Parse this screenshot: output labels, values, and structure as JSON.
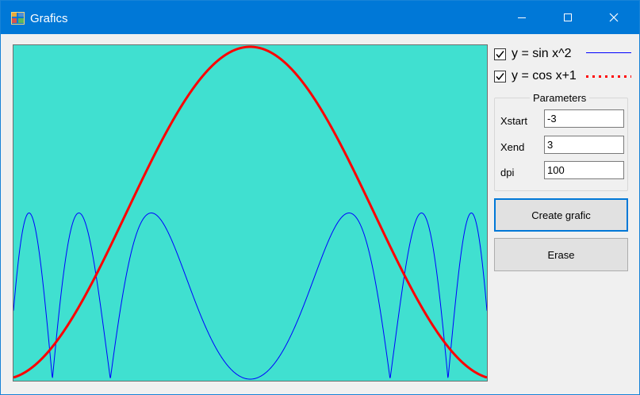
{
  "window": {
    "title": "Grafics",
    "app_icon": "windows-forms-icon",
    "controls": [
      "minimize-icon",
      "maximize-icon",
      "close-icon"
    ]
  },
  "checkboxes": [
    {
      "label": "y = sin x^2",
      "checked": true,
      "legend_style": "solid",
      "legend_color": "#0000ff"
    },
    {
      "label": "y = cos x+1",
      "checked": true,
      "legend_style": "dotted",
      "legend_color": "#ff0000"
    }
  ],
  "parameters": {
    "group_title": "Parameters",
    "xstart_label": "Xstart",
    "xstart_value": "-3",
    "xend_label": "Xend",
    "xend_value": "3",
    "dpi_label": "dpi",
    "dpi_value": "100"
  },
  "buttons": {
    "create_label": "Create grafic",
    "erase_label": "Erase"
  },
  "chart_data": {
    "type": "line",
    "background": "#40e0d0",
    "xlim": [
      -3,
      3
    ],
    "ylim": [
      0,
      2
    ],
    "grid": false,
    "series": [
      {
        "name": "y = sin x^2",
        "color": "#0000ff",
        "width": 1,
        "function": "sin(x^2)",
        "plotted_as": "abs",
        "x": [
          -3,
          -2.5,
          -2,
          -1.5,
          -1,
          -0.5,
          0,
          0.5,
          1,
          1.5,
          2,
          2.5,
          3
        ],
        "y": [
          0.41,
          0.03,
          0.76,
          0.78,
          0.84,
          0.25,
          0,
          0.25,
          0.84,
          0.78,
          0.76,
          0.03,
          0.41
        ]
      },
      {
        "name": "y = cos x+1",
        "color": "#ff0000",
        "width": 3,
        "function": "cos(x)+1",
        "x": [
          -3,
          -2.5,
          -2,
          -1.5,
          -1,
          -0.5,
          0,
          0.5,
          1,
          1.5,
          2,
          2.5,
          3
        ],
        "y": [
          0.01,
          0.2,
          0.58,
          1.07,
          1.54,
          1.88,
          2,
          1.88,
          1.54,
          1.07,
          0.58,
          0.2,
          0.01
        ]
      }
    ]
  }
}
